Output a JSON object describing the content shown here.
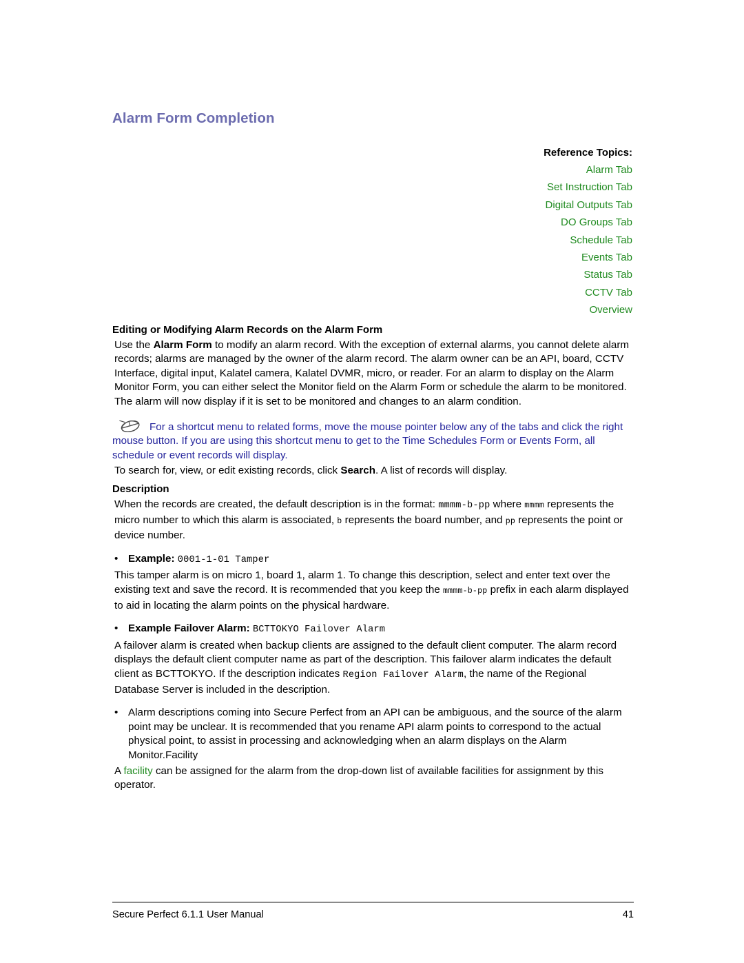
{
  "document": {
    "title": "Alarm Form Completion"
  },
  "reference_topics": {
    "label": "Reference Topics:",
    "links": [
      "Alarm Tab",
      "Set Instruction Tab",
      "Digital Outputs Tab",
      "DO Groups Tab",
      "Schedule Tab",
      "Events Tab",
      "Status Tab",
      "CCTV Tab",
      "Overview"
    ]
  },
  "sections": {
    "editing_heading": "Editing or Modifying Alarm Records on the Alarm Form",
    "intro": {
      "part1": "Use the ",
      "bold1": "Alarm Form",
      "part2": " to modify an alarm record. With the exception of external alarms, you cannot delete alarm records; alarms are managed by the owner of the alarm record. The alarm owner can be an API, board, CCTV Interface, digital input, Kalatel camera, Kalatel DVMR, micro, or reader. For an alarm to display on the Alarm Monitor Form, you can either select the Monitor field on the Alarm Form or schedule the alarm to be monitored. The alarm will now display if it is set to be monitored and changes to an alarm condition."
    },
    "note": {
      "icon": "mouse-icon",
      "text": "For a shortcut menu to related forms, move the mouse pointer below any of the tabs and click the right mouse button. If you are using this shortcut menu to get to the Time Schedules Form or Events Form, all schedule or event records will display."
    },
    "search_line": {
      "part1": "To search for, view, or edit existing records, click ",
      "bold1": "Search",
      "part2": ". A list of records will display."
    },
    "description_heading": "Description",
    "description_body": {
      "part1": "When the records are created, the default description is in the format: ",
      "mono1": "mmmm-b-pp",
      "part2": " where ",
      "mono2": "mmmm",
      "part3": " represents the micro number to which this alarm is associated, ",
      "mono3": "b",
      "part4": " represents the board number, and ",
      "mono4": "pp",
      "part5": " represents the point or device number."
    },
    "bullets": [
      {
        "marker": "•",
        "label": "Example:",
        "mono_value": "0001-1-01 Tamper"
      },
      {
        "marker": "•",
        "label": "Example Failover Alarm:",
        "mono_value": "BCTTOKYO Failover Alarm"
      }
    ],
    "example_body": {
      "part1": "This tamper alarm is on micro 1, board 1, alarm 1. To change this description, select and enter text over the existing text and save the record. It is recommended that you keep the ",
      "mono1": "mmmm-b-pp",
      "part2": " prefix in each alarm displayed to aid in locating the alarm points on the physical hardware."
    },
    "failover_body": {
      "part1": "A failover alarm is created when backup clients are assigned to the default client computer. The alarm record displays the default client computer name as part of the description. This failover alarm indicates the default client as BCTTOKYO. If the description indicates ",
      "mono1": "Region Failover Alarm",
      "part2": ", the name of the Regional Database Server is included in the description."
    },
    "api_bullet": {
      "marker": "•",
      "text": "Alarm descriptions coming into Secure Perfect from an API can be ambiguous, and the source of the alarm point may be unclear. It is recommended that you rename API alarm points to correspond to the actual physical point, to assist in processing and acknowledging when an alarm displays on the Alarm Monitor.Facility"
    },
    "facility_line": {
      "part1": "A ",
      "link": "facility",
      "part2": " can be assigned for the alarm from the drop-down list of available facilities for assignment by this operator."
    }
  },
  "footer": {
    "manual_name": "Secure Perfect 6.1.1 User Manual",
    "page_number": "41"
  },
  "colors": {
    "title": "#6C6CAF",
    "link_green": "#1F8A1F",
    "note_blue": "#24249C",
    "text": "#000000"
  }
}
